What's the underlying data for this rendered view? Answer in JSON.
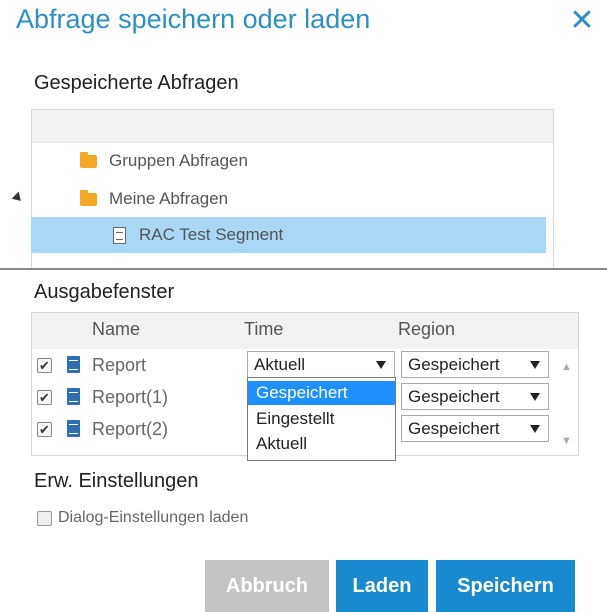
{
  "dialog": {
    "title": "Abfrage speichern oder laden",
    "close_label": "✕"
  },
  "saved_queries": {
    "section_title": "Gespeicherte Abfragen",
    "nodes": [
      {
        "label": "Gruppen Abfragen",
        "icon": "folder-icon"
      },
      {
        "label": "Meine Abfragen",
        "icon": "folder-open-icon"
      },
      {
        "label": "RAC Test Segment",
        "icon": "document-icon",
        "selected": true
      }
    ]
  },
  "output": {
    "section_title": "Ausgabefenster",
    "columns": [
      "Name",
      "Time",
      "Region"
    ],
    "rows": [
      {
        "name": "Report",
        "checked": true,
        "time": "Aktuell",
        "region": "Gespeichert"
      },
      {
        "name": "Report(1)",
        "checked": true,
        "time": "",
        "region": "Gespeichert"
      },
      {
        "name": "Report(2)",
        "checked": true,
        "time": "",
        "region": "Gespeichert"
      }
    ],
    "time_dropdown_options": [
      "Gespeichert",
      "Eingestellt",
      "Aktuell"
    ],
    "highlighted_option": "Gespeichert"
  },
  "advanced": {
    "section_title": "Erw. Einstellungen",
    "load_dialog_settings_label": "Dialog-Einstellungen laden",
    "load_dialog_settings_checked": false
  },
  "buttons": {
    "cancel": "Abbruch",
    "load": "Laden",
    "save": "Speichern"
  },
  "colors": {
    "accent": "#1a8ad0",
    "title": "#2c8fc9",
    "selection": "#a9d8f6",
    "dropdown_highlight": "#1e90ff",
    "disabled": "#c4c4c4"
  }
}
